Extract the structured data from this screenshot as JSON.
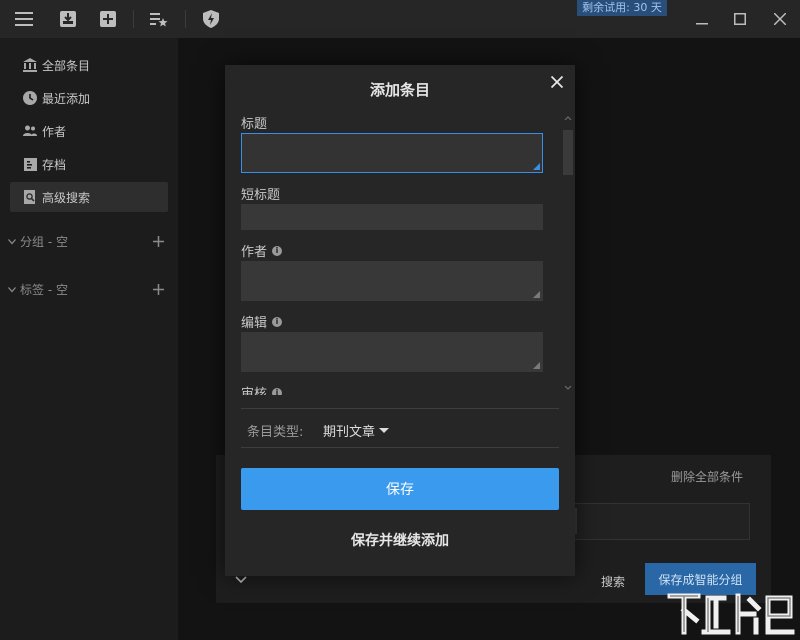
{
  "toolbar": {
    "icons": [
      "menu-icon",
      "inbox-download-icon",
      "add-box-icon",
      "playlist-star-icon",
      "shield-bolt-icon"
    ],
    "trial_text": "剩余试用: 30 天",
    "window_controls": [
      "minimize-icon",
      "maximize-icon",
      "close-icon"
    ]
  },
  "sidebar": {
    "items": [
      {
        "label": "全部条目",
        "icon": "library-icon"
      },
      {
        "label": "最近添加",
        "icon": "clock-icon"
      },
      {
        "label": "作者",
        "icon": "people-icon"
      },
      {
        "label": "存档",
        "icon": "archive-icon"
      },
      {
        "label": "高级搜索",
        "icon": "advanced-search-icon",
        "active": true
      }
    ],
    "groups_label": "分组 - 空",
    "tags_label": "标签 - 空"
  },
  "background": {
    "delete_all_label": "删除全部条件",
    "search_label": "搜索",
    "save_smart_group_label": "保存成智能分组"
  },
  "modal": {
    "title": "添加条目",
    "fields": {
      "title_label": "标题",
      "short_title_label": "短标题",
      "author_label": "作者",
      "editor_label": "编辑",
      "reviewer_label": "审核"
    },
    "type_label": "条目类型:",
    "type_value": "期刊文章",
    "save_label": "保存",
    "save_continue_label": "保存并继续添加"
  },
  "colors": {
    "accent": "#3a9aee",
    "focus_border": "#3a8ee6",
    "trial_badge": "#2a4e7a"
  }
}
